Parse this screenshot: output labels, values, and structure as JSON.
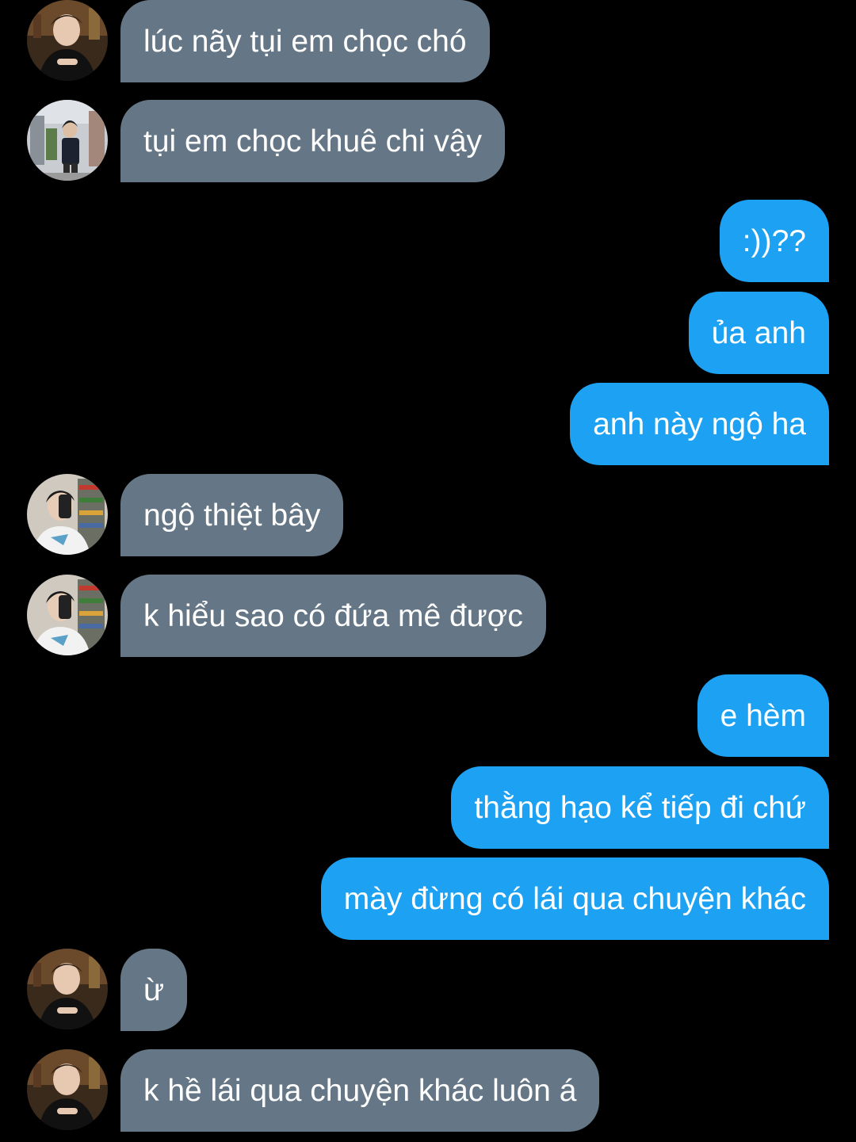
{
  "colors": {
    "background": "#000000",
    "received_bubble": "#657786",
    "sent_bubble": "#1da1f2",
    "text": "#ffffff"
  },
  "messages": [
    {
      "direction": "received",
      "avatar": "sender-a-avatar",
      "text": "lúc nãy tụi em chọc chó"
    },
    {
      "direction": "received",
      "avatar": "sender-b-avatar",
      "text": "tụi em chọc khuê chi vậy"
    },
    {
      "direction": "sent",
      "text": ":))??"
    },
    {
      "direction": "sent",
      "text": "ủa anh"
    },
    {
      "direction": "sent",
      "text": "anh này ngộ ha"
    },
    {
      "direction": "received",
      "avatar": "sender-c-avatar",
      "text": "ngộ thiệt bây"
    },
    {
      "direction": "received",
      "avatar": "sender-c-avatar",
      "text": "k hiểu sao có đứa mê được"
    },
    {
      "direction": "sent",
      "text": "e hèm"
    },
    {
      "direction": "sent",
      "text": "thằng hạo kể tiếp đi chứ"
    },
    {
      "direction": "sent",
      "text": "mày đừng có lái qua chuyện khác"
    },
    {
      "direction": "received",
      "avatar": "sender-a-avatar",
      "text": "ừ"
    },
    {
      "direction": "received",
      "avatar": "sender-a-avatar",
      "text": "k hề lái qua chuyện khác luôn á"
    }
  ]
}
